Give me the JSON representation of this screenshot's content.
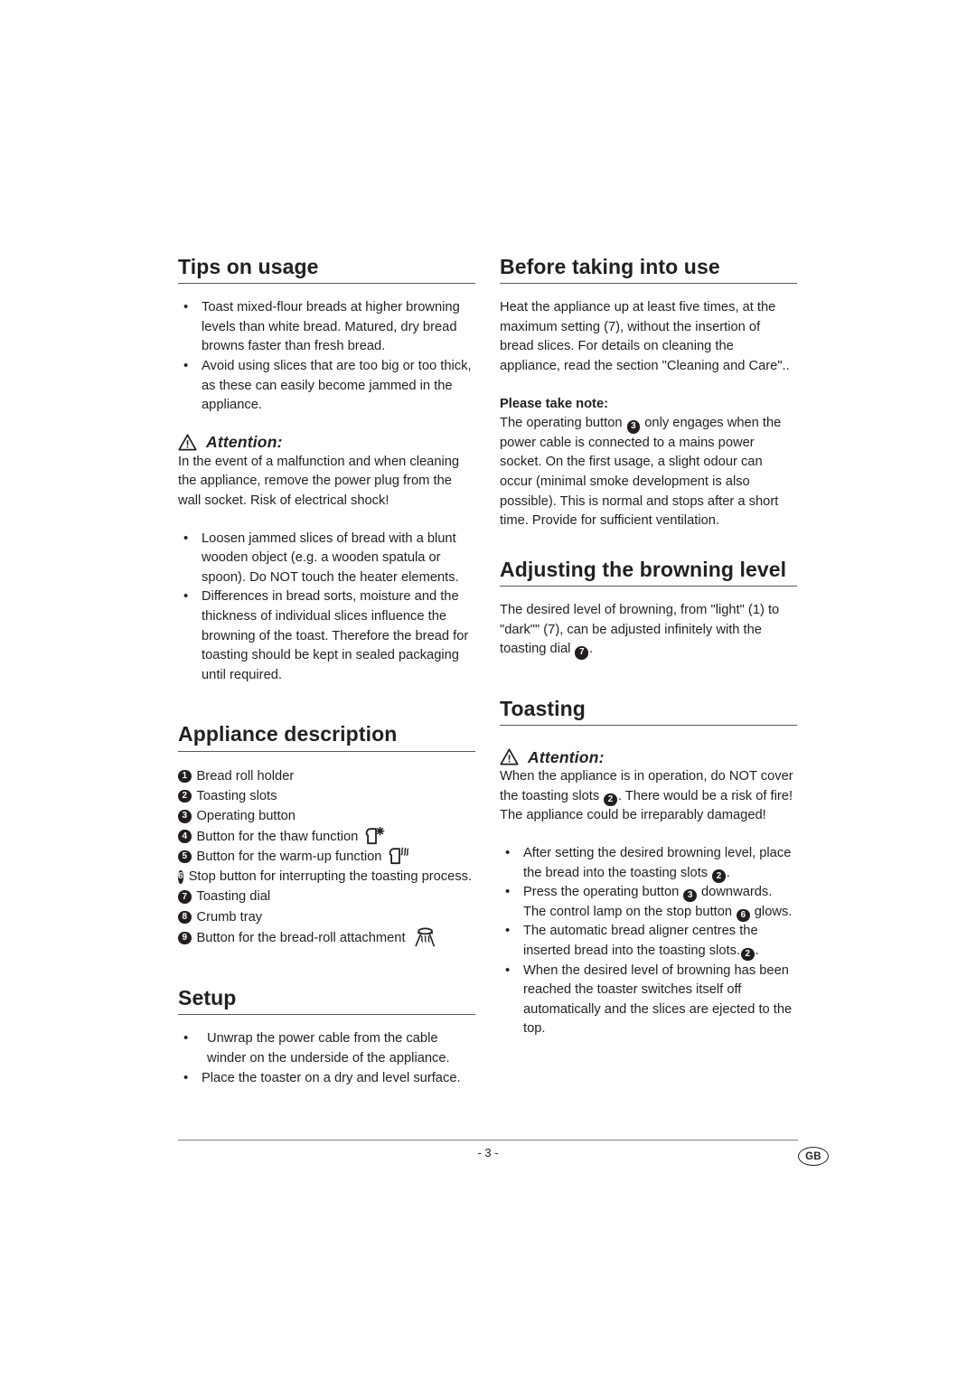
{
  "document": {
    "page_number": "- 3 -",
    "language_badge": "GB"
  },
  "left_column": {
    "tips": {
      "heading": "Tips on usage",
      "bullets": [
        "Toast mixed-flour breads at higher browning levels than white bread. Matured, dry bread browns faster than fresh bread.",
        "Avoid using slices that are too big or too thick, as these can easily become jammed in the appliance."
      ],
      "attention_label": "Attention:",
      "attention_icon": "warning-triangle-icon",
      "attention_text": "In the event of a malfunction and when cleaning the appliance, remove the power plug from the wall socket. Risk of electrical shock!",
      "bullets_after": [
        "Loosen jammed slices of bread with a blunt wooden object (e.g. a wooden spatula or spoon). Do NOT touch the heater elements.",
        "Differences in bread sorts, moisture and the thickness of individual slices influence the browning of the toast. Therefore the bread for toasting should be kept in sealed packaging until required."
      ]
    },
    "appliance_description": {
      "heading": "Appliance description",
      "items": [
        {
          "number": "1",
          "label": "Bread roll holder",
          "icon": ""
        },
        {
          "number": "2",
          "label": "Toasting slots",
          "icon": ""
        },
        {
          "number": "3",
          "label": "Operating button",
          "icon": ""
        },
        {
          "number": "4",
          "label": "Button for the thaw function",
          "icon": "bread-slice-snowflake-icon"
        },
        {
          "number": "5",
          "label": "Button for the warm-up function",
          "icon": "bread-slice-heatwave-icon"
        },
        {
          "number": "6",
          "label": "Stop button for interrupting the toasting process.",
          "icon": "bread-slice-stop-icon"
        },
        {
          "number": "7",
          "label": " Toasting dial",
          "icon": ""
        },
        {
          "number": "8",
          "label": "Crumb tray",
          "icon": ""
        },
        {
          "number": "9",
          "label": "Button for the bread-roll attachment",
          "icon": "bread-roll-rack-icon"
        }
      ]
    },
    "setup": {
      "heading": "Setup",
      "bullets": [
        " Unwrap the power cable from the cable winder on the underside of the appliance.",
        "Place the toaster on a dry and level surface."
      ]
    }
  },
  "right_column": {
    "before_use": {
      "heading": "Before taking into use",
      "paragraph": "Heat the appliance up at least five times, at the maximum setting (7), without the insertion of bread slices. For details on cleaning the appliance, read the section \"Cleaning and Care\"..",
      "note_label": "Please take note:",
      "note_part_1": "The operating button",
      "note_badge": "3",
      "note_part_2": "only engages when the power cable is connected to a mains power socket. On the first usage, a slight odour can occur (minimal smoke development is also possible). This is normal and stops after a short time. Provide for sufficient ventilation."
    },
    "browning": {
      "heading": "Adjusting the browning level",
      "part_1": " The desired level of browning, from \"light\" (1) to \"dark\"\" (7), can be adjusted infinitely with the toasting dial",
      "badge": "7",
      "part_2": "."
    },
    "toasting": {
      "heading": "Toasting",
      "attention_label": "Attention:",
      "attention_icon": "warning-triangle-icon",
      "attention_part_1": "When the appliance is in operation, do NOT cover the toasting slots",
      "attention_badge": "2",
      "attention_part_2": ". There would be a risk of fire! The appliance could be irreparably damaged!",
      "bullets": [
        {
          "part_1": "After setting the desired browning level, place the bread into the toasting slots",
          "badge_1": "2",
          "part_2": ".",
          "badge_2": "",
          "part_3": ""
        },
        {
          "part_1": "Press the operating button",
          "badge_1": "3",
          "part_2": "downwards. The control lamp on the stop button",
          "badge_2": "6",
          "part_3": "glows."
        },
        {
          "part_1": "The automatic bread aligner centres the inserted bread into the toasting slots.",
          "badge_1": "2",
          "part_2": ".",
          "badge_2": "",
          "part_3": ""
        },
        {
          "part_1": "When the desired level of browning has been reached the toaster switches itself off automatically and the slices are ejected to the top.",
          "badge_1": "",
          "part_2": "",
          "badge_2": "",
          "part_3": ""
        }
      ]
    }
  }
}
